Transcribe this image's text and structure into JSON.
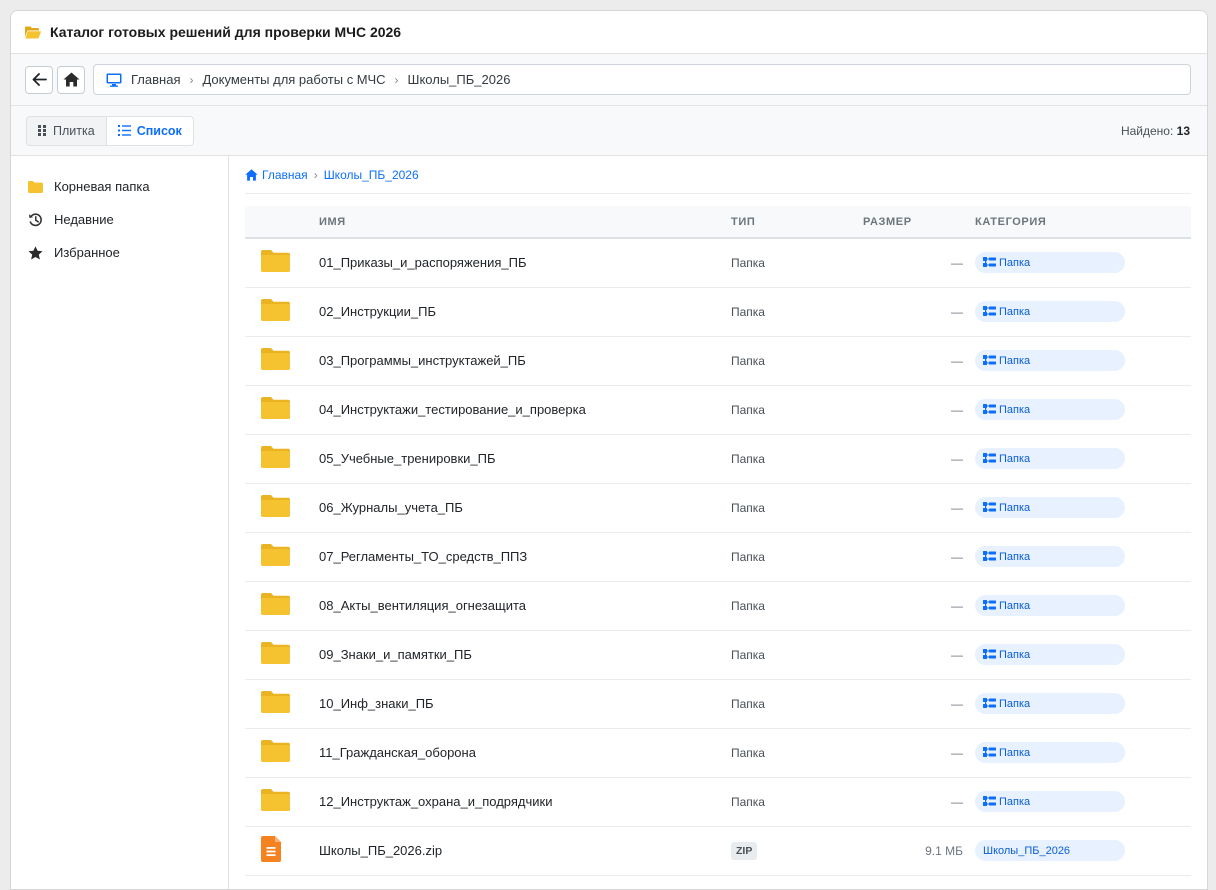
{
  "window": {
    "title": "Каталог готовых решений для проверки МЧС 2026",
    "title_icon": "folder-open-icon"
  },
  "navbar": {
    "back_icon": "arrow-left-icon",
    "home_icon": "home-icon",
    "address": {
      "icon": "monitor-icon",
      "path": [
        "Главная",
        "Документы для работы с МЧС",
        "Школы_ПБ_2026"
      ]
    }
  },
  "toolbar": {
    "view_tiles_label": "Плитка",
    "view_list_label": "Список",
    "active_view": "Список",
    "found_label": "Найдено:",
    "found_count": "13"
  },
  "sidebar": {
    "items": [
      {
        "label": "Корневая папка",
        "icon": "folder-icon"
      },
      {
        "label": "Недавние",
        "icon": "history-icon"
      },
      {
        "label": "Избранное",
        "icon": "star-icon"
      }
    ]
  },
  "breadcrumb": {
    "home_label": "Главная",
    "current": "Школы_ПБ_2026"
  },
  "table": {
    "columns": [
      "ИМЯ",
      "ТИП",
      "РАЗМЕР",
      "КАТЕГОРИЯ"
    ],
    "rows": [
      {
        "name": "01_Приказы_и_распоряжения_ПБ",
        "type": "Папка",
        "size": "—",
        "category": "Папка",
        "kind": "folder"
      },
      {
        "name": "02_Инструкции_ПБ",
        "type": "Папка",
        "size": "—",
        "category": "Папка",
        "kind": "folder"
      },
      {
        "name": "03_Программы_инструктажей_ПБ",
        "type": "Папка",
        "size": "—",
        "category": "Папка",
        "kind": "folder"
      },
      {
        "name": "04_Инструктажи_тестирование_и_проверка",
        "type": "Папка",
        "size": "—",
        "category": "Папка",
        "kind": "folder"
      },
      {
        "name": "05_Учебные_тренировки_ПБ",
        "type": "Папка",
        "size": "—",
        "category": "Папка",
        "kind": "folder"
      },
      {
        "name": "06_Журналы_учета_ПБ",
        "type": "Папка",
        "size": "—",
        "category": "Папка",
        "kind": "folder"
      },
      {
        "name": "07_Регламенты_ТО_средств_ППЗ",
        "type": "Папка",
        "size": "—",
        "category": "Папка",
        "kind": "folder"
      },
      {
        "name": "08_Акты_вентиляция_огнезащита",
        "type": "Папка",
        "size": "—",
        "category": "Папка",
        "kind": "folder"
      },
      {
        "name": "09_Знаки_и_памятки_ПБ",
        "type": "Папка",
        "size": "—",
        "category": "Папка",
        "kind": "folder"
      },
      {
        "name": "10_Инф_знаки_ПБ",
        "type": "Папка",
        "size": "—",
        "category": "Папка",
        "kind": "folder"
      },
      {
        "name": "11_Гражданская_оборона",
        "type": "Папка",
        "size": "—",
        "category": "Папка",
        "kind": "folder"
      },
      {
        "name": "12_Инструктаж_охрана_и_подрядчики",
        "type": "Папка",
        "size": "—",
        "category": "Папка",
        "kind": "folder"
      },
      {
        "name": "Школы_ПБ_2026.zip",
        "type": "ZIP",
        "size": "9.1 МБ",
        "category": "Школы_ПБ_2026",
        "kind": "zip"
      }
    ]
  },
  "colors": {
    "accent": "#0d6efd",
    "folder": "#f5c330",
    "zip": "#f58220",
    "category_bg": "#e7f1ff"
  }
}
